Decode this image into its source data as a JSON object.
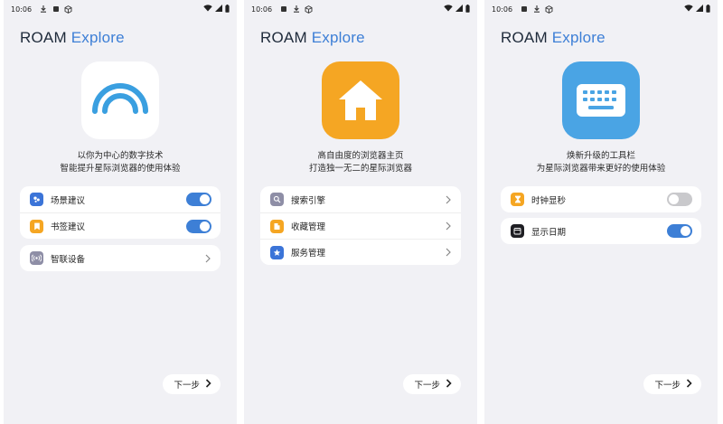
{
  "screens": [
    {
      "status": {
        "time": "10:06"
      },
      "brand": {
        "primary": "ROAM",
        "secondary": "Explore"
      },
      "hero_icon": "rainbow-arc-icon",
      "tagline": {
        "line1": "以你为中心的数字技术",
        "line2": "智能提升星际浏览器的使用体验"
      },
      "card1": [
        {
          "label": "场景建议",
          "icon": "scene-icon",
          "toggle": "on"
        },
        {
          "label": "书签建议",
          "icon": "bookmark-icon",
          "toggle": "on"
        }
      ],
      "card2": [
        {
          "label": "智联设备",
          "icon": "connected-devices-icon",
          "chevron": true
        }
      ],
      "next_label": "下一步"
    },
    {
      "status": {
        "time": "10:06"
      },
      "brand": {
        "primary": "ROAM",
        "secondary": "Explore"
      },
      "hero_icon": "home-icon",
      "tagline": {
        "line1": "高自由度的浏览器主页",
        "line2": "打造独一无二的星际浏览器"
      },
      "card1": [
        {
          "label": "搜索引擎",
          "icon": "search-icon",
          "chevron": true
        },
        {
          "label": "收藏管理",
          "icon": "favorites-icon",
          "chevron": true
        },
        {
          "label": "服务管理",
          "icon": "services-icon",
          "chevron": true
        }
      ],
      "next_label": "下一步"
    },
    {
      "status": {
        "time": "10:06"
      },
      "brand": {
        "primary": "ROAM",
        "secondary": "Explore"
      },
      "hero_icon": "keyboard-icon",
      "tagline": {
        "line1": "焕新升级的工具栏",
        "line2": "为星际浏览器带来更好的使用体验"
      },
      "card1": [
        {
          "label": "时钟显秒",
          "icon": "hourglass-icon",
          "toggle": "off"
        }
      ],
      "card2": [
        {
          "label": "显示日期",
          "icon": "calendar-icon",
          "toggle": "on"
        }
      ],
      "next_label": "下一步"
    }
  ],
  "colors": {
    "accent": "#3d7fd6",
    "screen_bg": "#f1f1f5",
    "hero_rainbow": "#3a9fe0",
    "hero_home": "#f5a623",
    "hero_keyboard": "#4aa4e4"
  }
}
